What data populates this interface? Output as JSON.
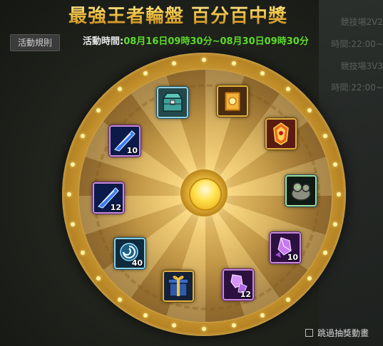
{
  "header": {
    "title": "最強王者輪盤  百分百中獎",
    "rules_label": "活動規則",
    "event_time_label": "活動時間:",
    "event_time_value": "08月16日09時30分~08月30日09時30分"
  },
  "background_panel": {
    "lines": [
      "競技場2V2",
      "時間:22:00~",
      "競技場3V3",
      "時間:22:00~"
    ]
  },
  "wheel": {
    "items": [
      {
        "name": "teal-chest",
        "qty": ""
      },
      {
        "name": "golden-book",
        "qty": ""
      },
      {
        "name": "flame-armor",
        "qty": ""
      },
      {
        "name": "stone-golem",
        "qty": ""
      },
      {
        "name": "purple-crystal",
        "qty": "10"
      },
      {
        "name": "purple-crystal-shards",
        "qty": "12"
      },
      {
        "name": "gift-box",
        "qty": ""
      },
      {
        "name": "swirl-orb",
        "qty": "40"
      },
      {
        "name": "blue-blade-shard",
        "qty": "12"
      },
      {
        "name": "blue-blade-shard",
        "qty": "10"
      }
    ]
  },
  "footer": {
    "skip_label": "跳過抽獎動畫"
  },
  "colors": {
    "title_gold": "#f4c94c",
    "time_green": "#5edb2c",
    "rim_gold": "#d6a53a",
    "item_border_purple": "#c98ad8"
  }
}
